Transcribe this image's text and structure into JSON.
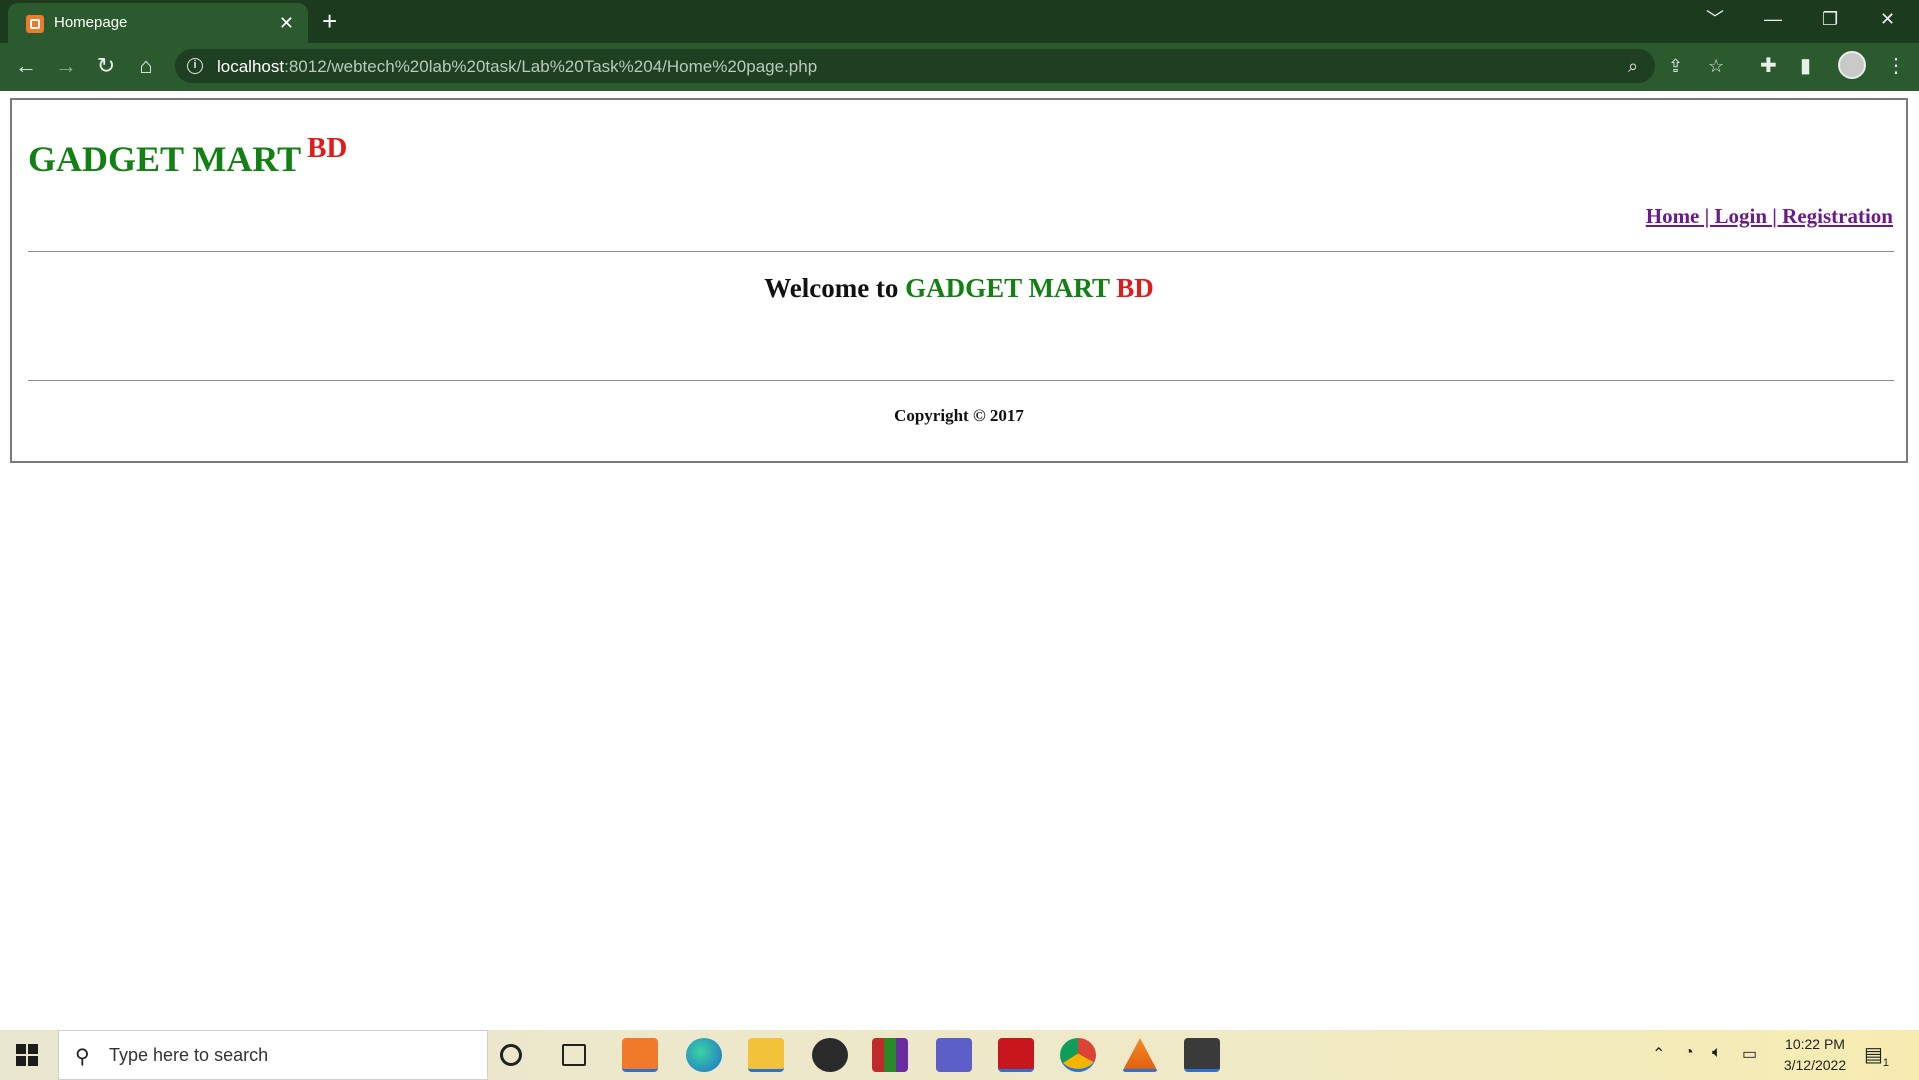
{
  "browser": {
    "tab_title": "Homepage",
    "tab_close": "✕",
    "new_tab": "+",
    "url_host": "localhost",
    "url_path": ":8012/webtech%20lab%20task/Lab%20Task%204/Home%20page.php",
    "window_controls": [
      "﹀",
      "—",
      "❐",
      "✕"
    ]
  },
  "page": {
    "brand_main": "GADGET MART",
    "brand_sup": "BD",
    "nav": {
      "home": "Home",
      "login": "Login",
      "registration": "Registration",
      "separator": " | "
    },
    "welcome_prefix": "Welcome to",
    "welcome_brand": "GADGET MART",
    "welcome_suffix": "BD",
    "copyright": "Copyright © 2017",
    "colors": {
      "green": "#128012",
      "red": "#e01b1b",
      "link": "#6a1a8a"
    }
  },
  "taskbar": {
    "search_placeholder": "Type here to search",
    "time": "10:22 PM",
    "date": "3/12/2022",
    "notification_count": "1",
    "apps": [
      "cortana-icon",
      "task-view-icon",
      "xampp-icon",
      "edge-icon",
      "file-explorer-icon",
      "obs-icon",
      "winrar-icon",
      "teams-icon",
      "acrobat-icon",
      "chrome-icon",
      "vlc-icon",
      "sublime-icon"
    ]
  }
}
